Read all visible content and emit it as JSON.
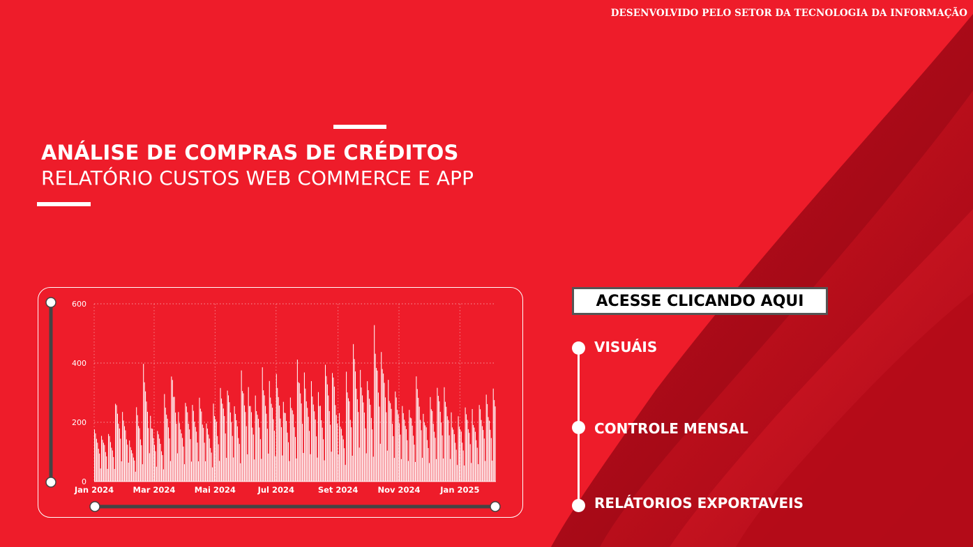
{
  "header": {
    "credit": "DESENVOLVIDO PELO SETOR DA TECNOLOGIA DA INFORMAÇÃO"
  },
  "hero": {
    "title": "ANÁLISE DE COMPRAS DE CRÉDITOS",
    "subtitle": "RELATÓRIO CUSTOS WEB COMMERCE E APP"
  },
  "access_button": {
    "label": "ACESSE CLICANDO AQUI"
  },
  "menu": {
    "items": [
      {
        "label": "VISUÁIS"
      },
      {
        "label": "CONTROLE MENSAL"
      },
      {
        "label": "RELÁTORIOS EXPORTAVEIS"
      }
    ]
  },
  "colors": {
    "background": "#ee1c2a",
    "fabric_dark": "#b00a18",
    "text": "#ffffff"
  },
  "chart_data": {
    "type": "bar",
    "x_start": "2024-01-01",
    "x_end": "2025-02-06",
    "x_ticks": [
      "Jan 2024",
      "Mar 2024",
      "Mai 2024",
      "Jul 2024",
      "Set 2024",
      "Nov 2024",
      "Jan 2025"
    ],
    "y_ticks": [
      0,
      200,
      400,
      600
    ],
    "ylim": [
      0,
      600
    ],
    "grid": true,
    "weekly_peaks": [
      185,
      170,
      175,
      290,
      255,
      140,
      255,
      400,
      220,
      180,
      300,
      390,
      235,
      290,
      270,
      290,
      200,
      275,
      350,
      340,
      255,
      380,
      320,
      300,
      380,
      350,
      360,
      290,
      310,
      420,
      370,
      335,
      315,
      405,
      395,
      230,
      370,
      480,
      390,
      360,
      530,
      460,
      340,
      320,
      280,
      265,
      350,
      250,
      300,
      340,
      330,
      230,
      230,
      260,
      240,
      285,
      300,
      330,
      340
    ]
  }
}
